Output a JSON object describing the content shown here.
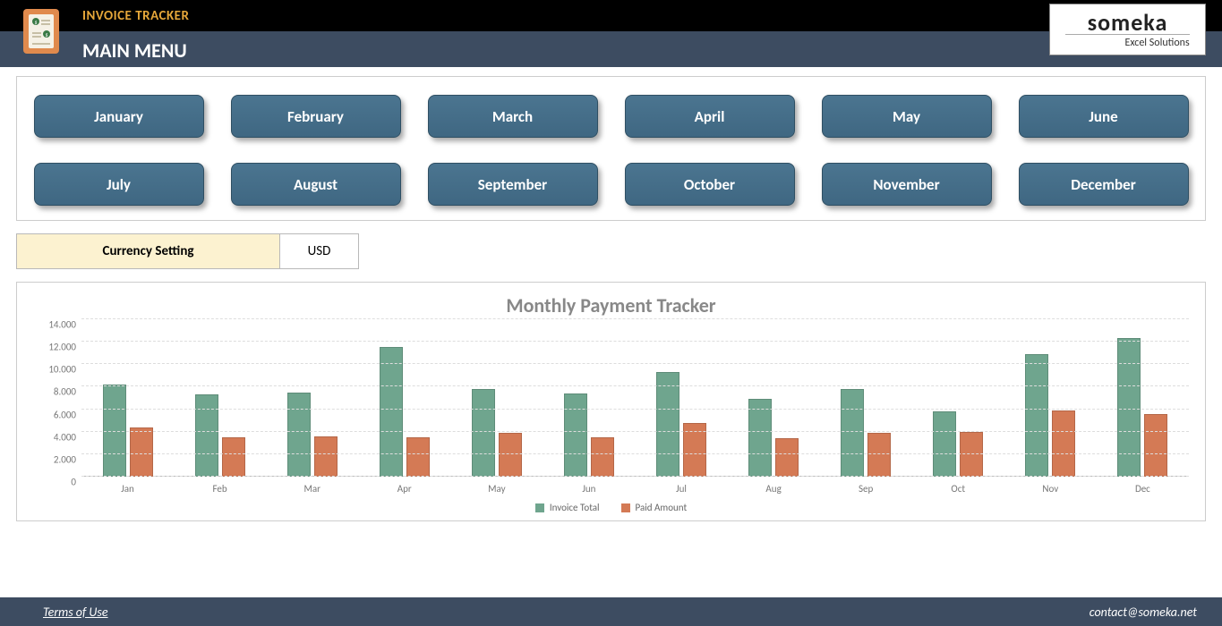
{
  "header": {
    "tracker_label": "INVOICE TRACKER",
    "page_title": "MAIN MENU",
    "logo_main": "someka",
    "logo_sub": "Excel Solutions"
  },
  "months": [
    "January",
    "February",
    "March",
    "April",
    "May",
    "June",
    "July",
    "August",
    "September",
    "October",
    "November",
    "December"
  ],
  "currency": {
    "label": "Currency Setting",
    "value": "USD"
  },
  "chart_data": {
    "type": "bar",
    "title": "Monthly Payment Tracker",
    "ylabel": "",
    "xlabel": "",
    "ylim": [
      0,
      14000
    ],
    "yticks": [
      0,
      2000,
      4000,
      6000,
      8000,
      10000,
      12000,
      14000
    ],
    "ytick_labels": [
      "0",
      "2.000",
      "4.000",
      "6.000",
      "8.000",
      "10.000",
      "12.000",
      "14.000"
    ],
    "categories": [
      "Jan",
      "Feb",
      "Mar",
      "Apr",
      "May",
      "Jun",
      "Jul",
      "Aug",
      "Sep",
      "Oct",
      "Nov",
      "Dec"
    ],
    "series": [
      {
        "name": "Invoice Total",
        "values": [
          8200,
          7300,
          7500,
          11500,
          7800,
          7400,
          9300,
          6900,
          7800,
          5800,
          10900,
          12300
        ]
      },
      {
        "name": "Paid Amount",
        "values": [
          4400,
          3500,
          3600,
          3500,
          3900,
          3500,
          4800,
          3400,
          3900,
          4000,
          5900,
          5600
        ]
      }
    ]
  },
  "footer": {
    "terms": "Terms of Use",
    "contact": "contact@someka.net"
  },
  "colors": {
    "series_a": "#6fa58e",
    "series_b": "#d47a55",
    "header_bg": "#3d4c61",
    "accent": "#e6a73a"
  }
}
